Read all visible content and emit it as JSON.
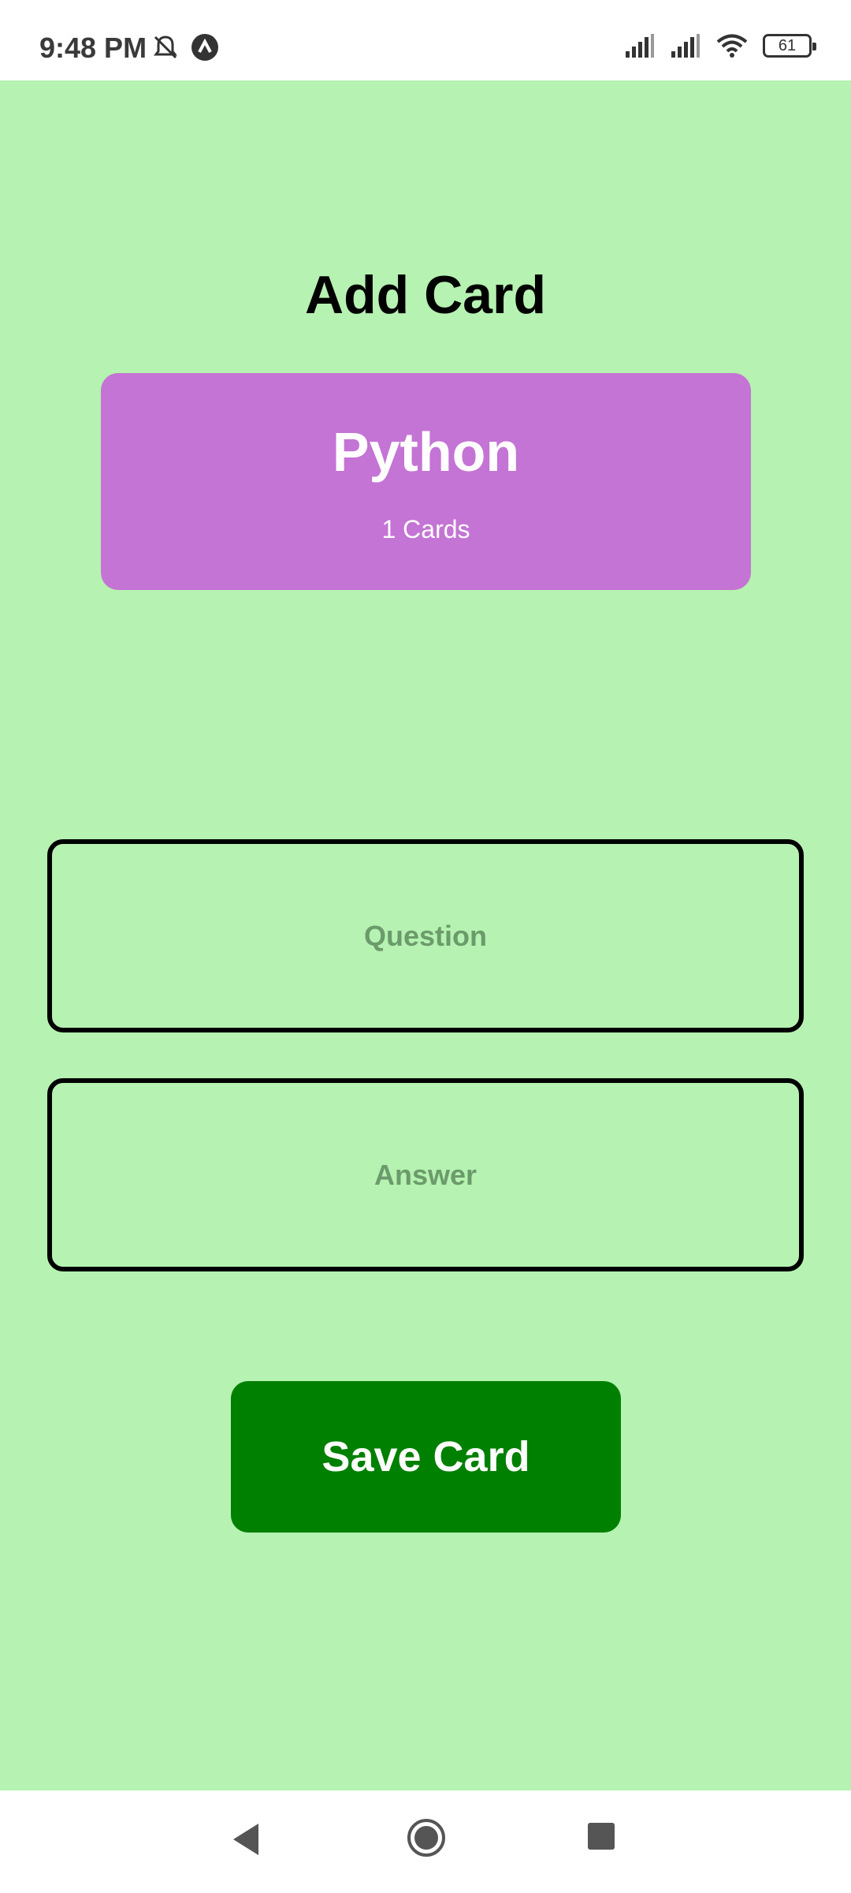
{
  "status_bar": {
    "time": "9:48 PM",
    "icons_left": [
      "mute-notifications-icon",
      "app-notification-icon"
    ],
    "icons_right": [
      "signal-icon",
      "signal-icon",
      "wifi-icon",
      "battery-icon"
    ],
    "battery_level": "61"
  },
  "screen": {
    "title": "Add Card",
    "background_color": "#b6f2b1"
  },
  "deck": {
    "name": "Python",
    "count_label": "1 Cards",
    "color": "#c474d4"
  },
  "form": {
    "question_placeholder": "Question",
    "question_value": "",
    "answer_placeholder": "Answer",
    "answer_value": "",
    "save_label": "Save Card",
    "save_color": "#008000"
  },
  "nav_bar": {
    "buttons": [
      "back-icon",
      "home-icon",
      "recents-icon"
    ]
  }
}
